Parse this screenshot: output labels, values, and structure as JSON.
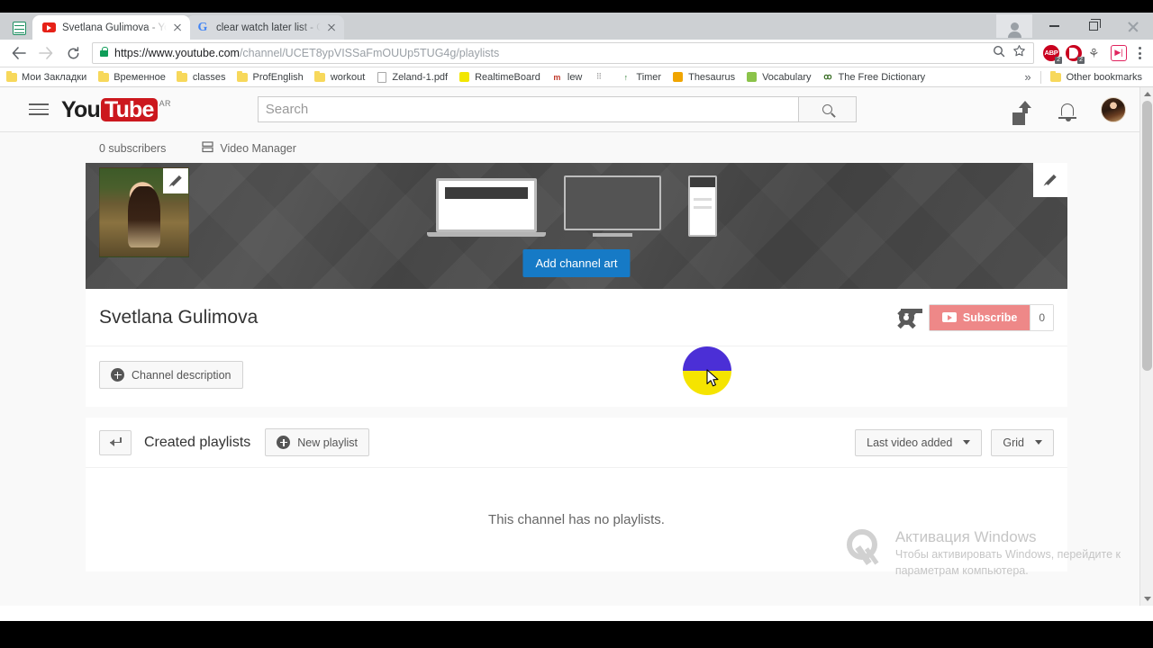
{
  "window": {
    "controls": {
      "profile": "profile-icon",
      "minimize": "—",
      "maximize": "▭",
      "close": "✕"
    }
  },
  "tabs": [
    {
      "title": "Svetlana Gulimova - You",
      "favicon": "youtube-icon",
      "active": true
    },
    {
      "title": "clear watch later list - Go",
      "favicon": "google-icon",
      "active": false
    }
  ],
  "toolbar": {
    "back": "←",
    "forward": "→",
    "reload": "⟳",
    "url_prefix": "https://www.youtube.com",
    "url_rest": "/channel/UCET8ypVISSaFmOUUp5TUG4g/playlists",
    "zoom_icon": "zoom-search-icon",
    "bookmark_star": "☆",
    "extensions": [
      {
        "name": "adblock-plus",
        "label": "ABP",
        "badge": "2"
      },
      {
        "name": "pomodoro-timer",
        "label": "",
        "badge": "2"
      },
      {
        "name": "grayscale-extension",
        "label": "⚘",
        "badge": ""
      },
      {
        "name": "video-speed-extension",
        "label": "▶|",
        "badge": ""
      }
    ],
    "menu": "chrome-menu-icon"
  },
  "bookmarks": {
    "items": [
      {
        "label": "Мои Закладки",
        "icon": "folder"
      },
      {
        "label": "Временное",
        "icon": "folder"
      },
      {
        "label": "classes",
        "icon": "folder"
      },
      {
        "label": "ProfEnglish",
        "icon": "folder"
      },
      {
        "label": "workout",
        "icon": "folder"
      },
      {
        "label": "Zeland-1.pdf",
        "icon": "pdf"
      },
      {
        "label": "RealtimeBoard",
        "icon": "yellow-square"
      },
      {
        "label": "lew",
        "icon": "site"
      },
      {
        "label": "",
        "icon": "site-blank"
      },
      {
        "label": "Timer",
        "icon": "site"
      },
      {
        "label": "Thesaurus",
        "icon": "site"
      },
      {
        "label": "Vocabulary",
        "icon": "site"
      },
      {
        "label": "The Free Dictionary",
        "icon": "site"
      }
    ],
    "overflow": "»",
    "other": "Other bookmarks"
  },
  "youtube": {
    "logo_you": "You",
    "logo_tube": "Tube",
    "country_code": "AR",
    "search_placeholder": "Search",
    "search_value": "",
    "icons": {
      "menu": "hamburger-icon",
      "search": "search-icon",
      "upload": "upload-icon",
      "notifications": "bell-icon",
      "account": "account-avatar"
    }
  },
  "channel": {
    "subscribers": "0 subscribers",
    "video_manager": "Video Manager",
    "add_channel_art": "Add channel art",
    "name": "Svetlana Gulimova",
    "subscribe_label": "Subscribe",
    "subscribe_count": "0",
    "description_button": "Channel description",
    "settings_icon": "gear-icon",
    "edit_avatar_icon": "pencil-icon",
    "edit_banner_icon": "pencil-icon"
  },
  "playlists": {
    "back_icon": "back-arrow-icon",
    "title": "Created playlists",
    "new_playlist": "New playlist",
    "sort_value": "Last video added",
    "view_value": "Grid",
    "empty_message": "This channel has no playlists."
  },
  "watermark": {
    "title": "Активация Windows",
    "line1": "Чтобы активировать Windows, перейдите к",
    "line2": "параметрам компьютера."
  },
  "colors": {
    "youtube_red": "#cc181e",
    "add_art_blue": "#167ac6",
    "subscribe_muted": "#e88888",
    "click_highlight_top": "#4b2fd6",
    "click_highlight_bottom": "#f5e400"
  }
}
